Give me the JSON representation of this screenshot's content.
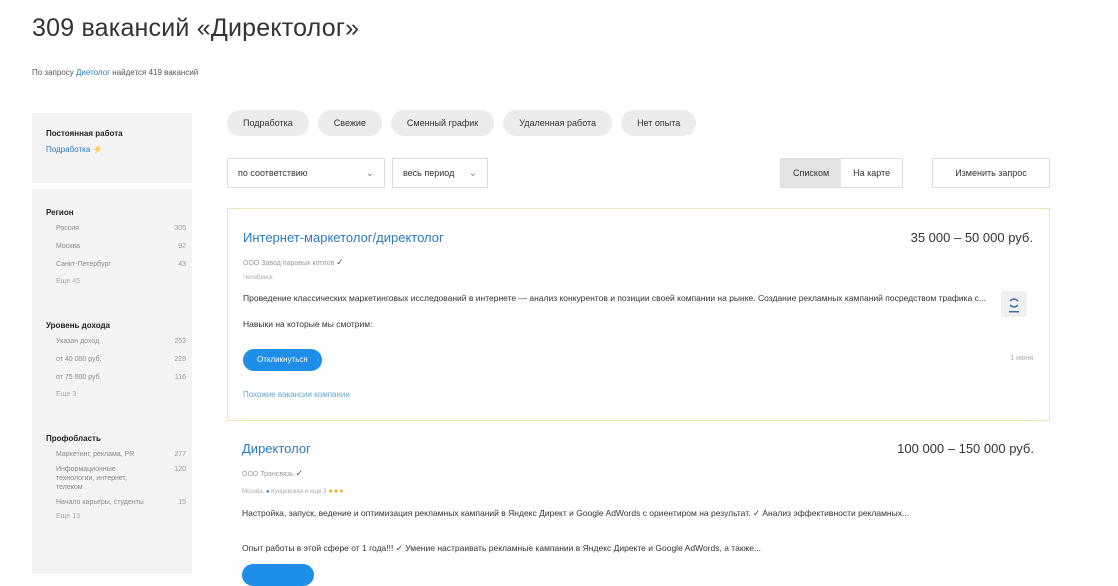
{
  "header": {
    "title": "309 вакансий «Директолог»",
    "subtitle_prefix": "По запросу",
    "subtitle_link": "Диетолог",
    "subtitle_suffix": "найдется 419 вакансий"
  },
  "sidebar": {
    "employment": {
      "heading": "Постоянная работа",
      "link": "Подработка"
    },
    "region": {
      "heading": "Регион",
      "items": [
        {
          "label": "Россия",
          "count": "305"
        },
        {
          "label": "Москва",
          "count": "92"
        },
        {
          "label": "Санкт-Петербург",
          "count": "43"
        }
      ],
      "more": "Еще 45"
    },
    "income": {
      "heading": "Уровень дохода",
      "items": [
        {
          "label": "Указан доход",
          "count": "253"
        },
        {
          "label": "от 40 000 руб.",
          "count": "228"
        },
        {
          "label": "от 75 000 руб.",
          "count": "116"
        }
      ],
      "more": "Еще 3"
    },
    "field": {
      "heading": "Профобласть",
      "items": [
        {
          "label": "Маркетинг, реклама, PR",
          "count": "277"
        },
        {
          "label": "Информационные технологии, интернет, телеком",
          "count": "120"
        },
        {
          "label": "Начало карьеры, студенты",
          "count": "15"
        }
      ],
      "more": "Еще 13"
    }
  },
  "chips": [
    "Подработка",
    "Свежие",
    "Сменный график",
    "Удаленная работа",
    "Нет опыта"
  ],
  "controls": {
    "sort": "по соответствию",
    "period": "весь период",
    "view_list": "Списком",
    "view_map": "На карте",
    "change_query": "Изменить запрос"
  },
  "vacancies": [
    {
      "title": "Интернет-маркетолог/директолог",
      "salary": "35 000 – 50 000 руб.",
      "company": "ООО Завод паровых котлов",
      "location": "Челябинск",
      "description": "Проведение классических маркетинговых исследований в интернете — анализ конкурентов и позиции своей компании на рынке. Создание рекламных кампаний посредством трафика с...",
      "requirement": "Навыки на которые мы смотрим:",
      "respond": "Откликнуться",
      "date": "1 июня",
      "similar": "Похожие вакансии компании"
    },
    {
      "title": "Директолог",
      "salary": "100 000 – 150 000 руб.",
      "company": "ООО Трансвязь",
      "location": "Москва,",
      "metro": "Кунцевская и еще 3",
      "stars": "★★★",
      "description": "Настройка, запуск, ведение и оптимизация рекламных кампаний в Яндекс Директ и Google AdWords с ориентиром на результат. ✓ Анализ эффективности рекламных...",
      "requirement": "Опыт работы в этой сфере от 1 года!!! ✓ Умение настраивать рекламные кампании в Яндекс Директе и Google AdWords, а также..."
    }
  ]
}
